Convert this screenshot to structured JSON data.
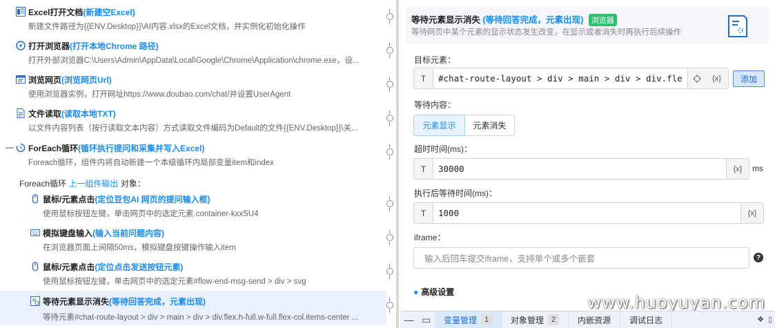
{
  "steps": [
    {
      "name": "Excel打开文档",
      "sub": "(新建空Excel)",
      "desc": "新建文件路径为{{ENV.Desktop}}\\AI内容.xlsx的Excel文档，并实例化初始化操作",
      "icon": "excel-icon"
    },
    {
      "name": "打开浏览器",
      "sub": "(打开本地Chrome 路径)",
      "desc": "打开外部浏览器C:\\Users\\Admin\\AppData\\Local\\Google\\Chrome\\Application\\chrome.exe，设...",
      "icon": "compass-icon"
    },
    {
      "name": "浏览网页",
      "sub": "(浏览网页Url)",
      "desc": "使用浏览器实例，打开网址https://www.doubao.com/chat/并设置UserAgent",
      "icon": "browser-window-icon"
    },
    {
      "name": "文件读取",
      "sub": "(读取本地TXT)",
      "desc": "以文件内容列表（按行读取文本内容）方式读取文件编码为Default的文件{{ENV.Desktop}}\\关...",
      "icon": "file-read-icon"
    },
    {
      "name": "ForEach循环",
      "sub": " (循环执行提问和采集并写入Excel)",
      "desc": "Foreach循环，组件内将自动新建一个本级循环内局部变量item和index",
      "icon": "loop-icon"
    }
  ],
  "foreach_line": {
    "prefix": "Foreach循环 ",
    "link": "上一组件输出",
    "suffix": " 对象："
  },
  "nested_steps": [
    {
      "name": "鼠标/元素点击",
      "sub": "(定位豆包AI 网页的提问输入框)",
      "desc": "使用鼠标按钮左键，单击网页中的选定元素.container-kxxSU4",
      "icon": "mouse-icon"
    },
    {
      "name": "模拟键盘输入",
      "sub": "(输入当前问题内容)",
      "desc": "在浏览器页面上间隔50ms，模拟键盘按键操作输入item",
      "icon": "keyboard-icon"
    },
    {
      "name": "鼠标/元素点击",
      "sub": "(定位点击发送按钮元素)",
      "desc": "使用鼠标按钮左键，单击网页中的选定元素#flow-end-msg-send > div > svg",
      "icon": "mouse-icon"
    },
    {
      "name": "等待元素显示消失",
      "sub": "(等待回答完成，元素出现)",
      "desc": "等待元素#chat-route-layout > div > main > div > div.flex.h-full.w-full.flex-col.items-center ...",
      "icon": "wait-element-icon"
    }
  ],
  "collapse_symbol": "—",
  "detail": {
    "title": "等待元素显示消失",
    "title_sub": " (等待回答完成，元素出现)",
    "badge": "浏览器",
    "desc": "等待网页中某个元素的显示状态发生改变，在显示或者消失时再执行后续操作",
    "target_label": "目标元素：",
    "target_prefix": "T",
    "target_value": "#chat-route-layout > div > main > div > div.fle",
    "var_btn": "{x}",
    "add_btn": "添加",
    "wait_label": "等待内容：",
    "seg_show": "元素显示",
    "seg_hide": "元素消失",
    "timeout_label": "超时时间(ms)：",
    "timeout_value": "30000",
    "ms_unit": "ms",
    "after_label": "执行后等待时间(ms)：",
    "after_value": "1000",
    "iframe_label": "iframe：",
    "iframe_placeholder": "输入后回车提交iframe，支持单个或多个嵌套",
    "help": "?",
    "advanced": "高级设置"
  },
  "bottom": {
    "tabs": [
      {
        "label": "变量管理",
        "count": "1"
      },
      {
        "label": "对象管理",
        "count": "2"
      },
      {
        "label": "内嵌资源",
        "count": ""
      },
      {
        "label": "调试日志",
        "count": ""
      }
    ]
  },
  "watermark": "www.huoyuyan.com",
  "colors": {
    "accent": "#1a8cf0",
    "badge": "#2fbf71",
    "selected_bg": "#eaf1fc"
  }
}
